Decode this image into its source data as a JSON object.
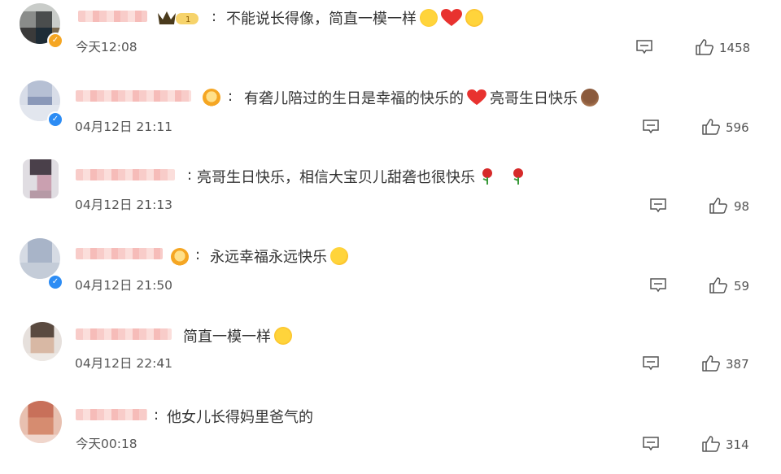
{
  "comments": [
    {
      "text": "不能说长得像，简直一模一样",
      "time": "今天12:08",
      "likes": "1458"
    },
    {
      "text": "有砻儿陪过的生日是幸福的快乐的",
      "text2": "亮哥生日快乐",
      "time": "04月12日 21:11",
      "likes": "596"
    },
    {
      "text": "亮哥生日快乐，相信大宝贝儿甜砻也很快乐",
      "time": "04月12日 21:13",
      "likes": "98"
    },
    {
      "text": "永远幸福永远快乐",
      "time": "04月12日 21:50",
      "likes": "59"
    },
    {
      "text": "简直一模一样",
      "time": "04月12日 22:41",
      "likes": "387"
    },
    {
      "text": "他女儿长得妈里爸气的",
      "time": "今天00:18",
      "likes": "314"
    }
  ],
  "colon": ":",
  "icons": {
    "reply": "comment-bubble-icon",
    "like": "thumbs-up-icon",
    "badge": "crown-icon",
    "vip": "vip-level-icon"
  },
  "colors": {
    "name_blur": "#f8c9c6",
    "heart": "#e8322f",
    "verified": "#2c8cf4"
  }
}
